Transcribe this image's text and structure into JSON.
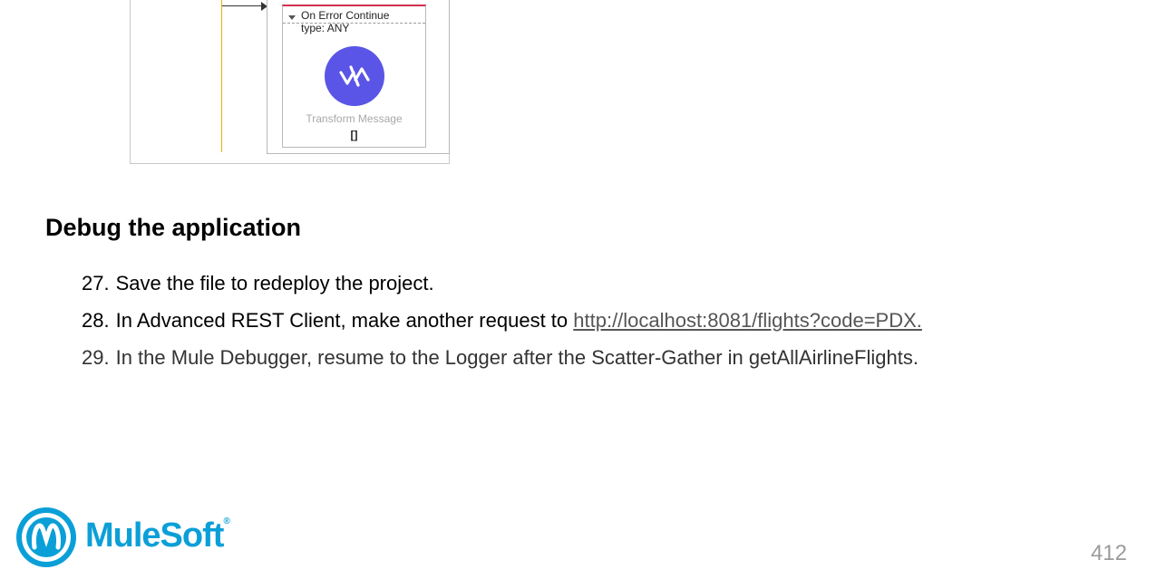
{
  "diagram": {
    "error_handler": {
      "title": "On Error Continue",
      "type_label": "type: ANY"
    },
    "transform": {
      "label": "Transform Message",
      "value": "[]"
    },
    "colors": {
      "flow_line": "#e6b800",
      "error_accent": "#d0314a",
      "transform_icon": "#5a55e6"
    }
  },
  "section": {
    "heading": "Debug the application",
    "steps": [
      {
        "num": "27.",
        "text": "Save the file to redeploy the project."
      },
      {
        "num": "28.",
        "text": "In Advanced REST Client, make another request to ",
        "link": "http://localhost:8081/flights?code=PDX."
      },
      {
        "num": "29.",
        "text": "In the Mule Debugger, resume to the Logger after the Scatter-Gather in getAllAirlineFlights."
      }
    ]
  },
  "footer": {
    "logo_text": "MuleSoft",
    "logo_mark": "®",
    "logo_color": "#0b9fd8",
    "page_number": "412"
  }
}
